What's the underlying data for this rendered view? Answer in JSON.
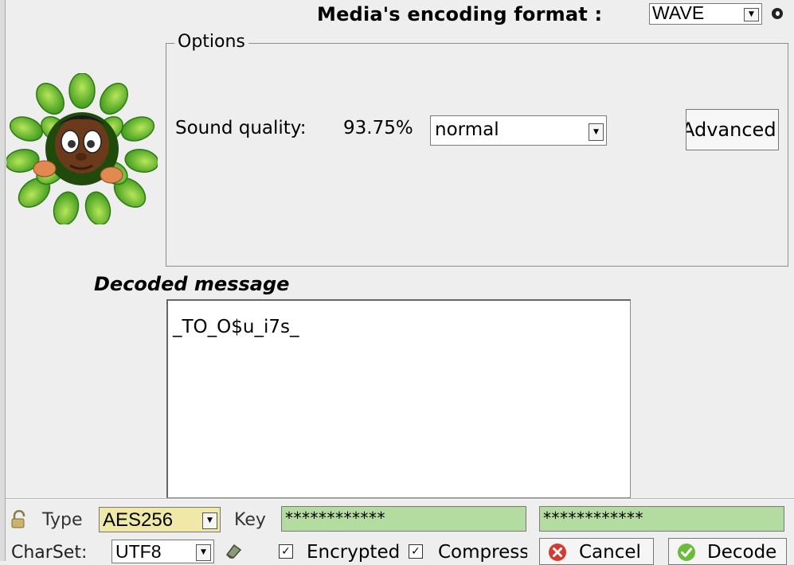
{
  "header": {
    "encoding_label": "Media's encoding format :",
    "encoding_value": "WAVE"
  },
  "options": {
    "legend": "Options",
    "sound_quality_label": "Sound quality:",
    "sound_quality_value": "93.75%",
    "quality_mode": "normal",
    "advanced_label": "Advanced"
  },
  "decoded": {
    "label": "Decoded message",
    "text": "_TO_O$u_i7s_"
  },
  "crypto": {
    "type_label": "Type",
    "type_value": "AES256",
    "key_label": "Key",
    "key_value": "************",
    "key_confirm_value": "************"
  },
  "bottom": {
    "charset_label": "CharSet:",
    "charset_value": "UTF8",
    "encrypted_label": "Encrypted",
    "encrypted_checked": true,
    "compress_label": "Compress",
    "compress_checked": true,
    "cancel_label": "Cancel",
    "decode_label": "Decode"
  },
  "icons": {
    "mascot": "mascot-leaf-character",
    "lock": "lock-icon",
    "eraser": "eraser-icon",
    "cancel": "cancel-red-x-icon",
    "decode": "check-green-icon"
  },
  "colors": {
    "key_field_bg": "#b5dca0",
    "type_select_bg": "#f0e8a6",
    "window_bg": "#eeeeee"
  }
}
